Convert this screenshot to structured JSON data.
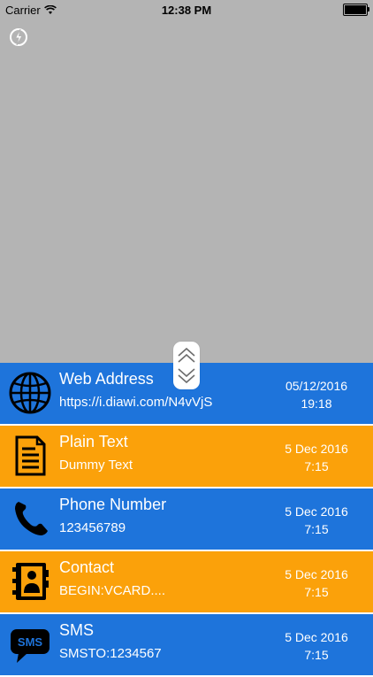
{
  "status_bar": {
    "carrier": "Carrier",
    "time": "12:38 PM",
    "battery_level": 1.0
  },
  "colors": {
    "blue": "#1e74db",
    "orange": "#fba10a",
    "camera_bg": "#b4b4b4"
  },
  "history": [
    {
      "type": "web-address",
      "icon": "globe-icon",
      "title": "Web Address",
      "content": "https://i.diawi.com/N4vVjS",
      "date": "05/12/2016",
      "time": "19:18",
      "color": "#1e74db"
    },
    {
      "type": "plain-text",
      "icon": "document-icon",
      "title": "Plain Text",
      "content": "Dummy Text",
      "date": "5 Dec 2016",
      "time": "7:15",
      "color": "#fba10a"
    },
    {
      "type": "phone-number",
      "icon": "phone-icon",
      "title": "Phone Number",
      "content": "123456789",
      "date": "5 Dec 2016",
      "time": "7:15",
      "color": "#1e74db"
    },
    {
      "type": "contact",
      "icon": "contact-book-icon",
      "title": "Contact",
      "content": "BEGIN:VCARD....",
      "date": "5 Dec 2016",
      "time": "7:15",
      "color": "#fba10a"
    },
    {
      "type": "sms",
      "icon": "sms-icon",
      "title": "SMS",
      "icon_label": "SMS",
      "content": "SMSTO:1234567",
      "date": "5 Dec 2016",
      "time": "7:15",
      "color": "#1e74db"
    }
  ]
}
